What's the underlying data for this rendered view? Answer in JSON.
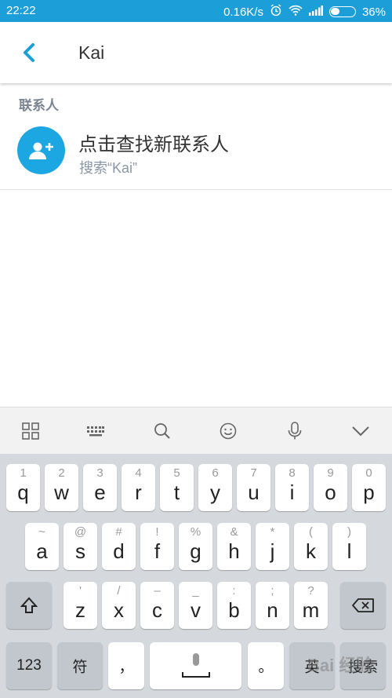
{
  "status_bar": {
    "time": "22:22",
    "net_speed": "0.16K/s",
    "battery": "36%"
  },
  "header": {
    "query": "Kai"
  },
  "section": {
    "label": "联系人"
  },
  "contact_row": {
    "title": "点击查找新联系人",
    "subtitle": "搜索“Kai”"
  },
  "accent_color": "#1C9FD8",
  "keyboard": {
    "row1": [
      {
        "main": "q",
        "sub": "1"
      },
      {
        "main": "w",
        "sub": "2"
      },
      {
        "main": "e",
        "sub": "3"
      },
      {
        "main": "r",
        "sub": "4"
      },
      {
        "main": "t",
        "sub": "5"
      },
      {
        "main": "y",
        "sub": "6"
      },
      {
        "main": "u",
        "sub": "7"
      },
      {
        "main": "i",
        "sub": "8"
      },
      {
        "main": "o",
        "sub": "9"
      },
      {
        "main": "p",
        "sub": "0"
      }
    ],
    "row2": [
      {
        "main": "a",
        "sub": "~"
      },
      {
        "main": "s",
        "sub": "@"
      },
      {
        "main": "d",
        "sub": "#"
      },
      {
        "main": "f",
        "sub": "!"
      },
      {
        "main": "g",
        "sub": "%"
      },
      {
        "main": "h",
        "sub": "&"
      },
      {
        "main": "j",
        "sub": "*"
      },
      {
        "main": "k",
        "sub": "("
      },
      {
        "main": "l",
        "sub": ")"
      }
    ],
    "row3": [
      {
        "main": "z",
        "sub": "'"
      },
      {
        "main": "x",
        "sub": "/"
      },
      {
        "main": "c",
        "sub": "–"
      },
      {
        "main": "v",
        "sub": "_"
      },
      {
        "main": "b",
        "sub": ":"
      },
      {
        "main": "n",
        "sub": ";"
      },
      {
        "main": "m",
        "sub": "?"
      }
    ],
    "num_label": "123",
    "symbol_label": "符",
    "comma_label": "，",
    "period_label": "。",
    "lang_label": "英",
    "search_label": "搜索"
  },
  "watermark": "Bai 经验"
}
